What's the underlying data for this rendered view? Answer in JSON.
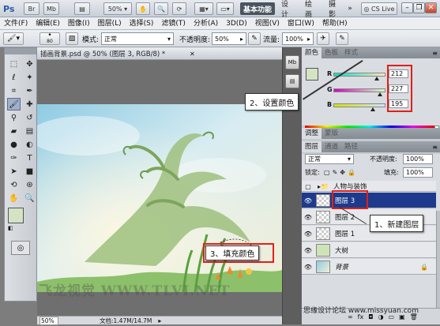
{
  "app": {
    "logo": "Ps"
  },
  "titlebar": {
    "zoom": "50%",
    "workspaces": [
      "基本功能",
      "设计",
      "绘画",
      "摄影"
    ],
    "more": "»",
    "cs_live": "CS Live"
  },
  "menu": [
    "文件(F)",
    "编辑(E)",
    "图像(I)",
    "图层(L)",
    "选择(S)",
    "滤镜(T)",
    "分析(A)",
    "3D(D)",
    "视图(V)",
    "窗口(W)",
    "帮助(H)"
  ],
  "options": {
    "brush_size": "80",
    "mode_label": "模式:",
    "mode_value": "正常",
    "opacity_label": "不透明度:",
    "opacity_value": "50%",
    "flow_label": "流量:",
    "flow_value": "100%"
  },
  "document": {
    "tab_title": "插画背景.psd @ 50% (图层 3, RGB/8) *",
    "zoom": "50%",
    "doc_info": "文档:1.47M/14.7M"
  },
  "color_panel": {
    "tabs": [
      "颜色",
      "色板",
      "样式"
    ],
    "r_label": "R",
    "g_label": "G",
    "b_label": "B",
    "r_value": "212",
    "g_value": "227",
    "b_value": "195",
    "r_pos": 0.83,
    "g_pos": 0.89,
    "b_pos": 0.76,
    "foreground": "#d4e3c3"
  },
  "adjust_tabs": [
    "调整",
    "蒙版"
  ],
  "layers_panel": {
    "tabs": [
      "图层",
      "通道",
      "路径"
    ],
    "blend_mode": "正常",
    "opacity_label": "不透明度:",
    "opacity_value": "100%",
    "lock_label": "锁定:",
    "fill_label": "填充:",
    "fill_value": "100%",
    "layers": [
      {
        "name": "人物与装饰",
        "type": "group",
        "visible": false
      },
      {
        "name": "图层 3",
        "type": "layer",
        "selected": true
      },
      {
        "name": "图层 2",
        "type": "layer"
      },
      {
        "name": "图层 1",
        "type": "layer"
      },
      {
        "name": "大树",
        "type": "layer"
      },
      {
        "name": "背景",
        "type": "background",
        "locked": true
      }
    ]
  },
  "annotations": {
    "step1": "1、新建图层",
    "step2": "2、设置颜色",
    "step3": "3、填充颜色",
    "accent": "#e0201a"
  },
  "watermarks": {
    "main": "飞龙视觉 WWW.TLVI.NET",
    "corner": "思缘设计论坛  www.missyuan.com"
  }
}
